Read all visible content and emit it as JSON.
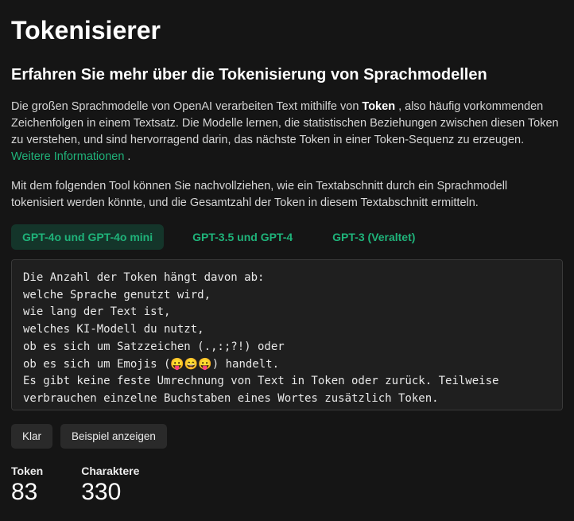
{
  "title": "Tokenisierer",
  "subtitle": "Erfahren Sie mehr über die Tokenisierung von Sprachmodellen",
  "para1_pre": "Die großen Sprachmodelle von OpenAI verarbeiten Text mithilfe von ",
  "para1_strong": "Token",
  "para1_post": " , also häufig vorkommenden Zeichenfolgen in einem Textsatz. Die Modelle lernen, die statistischen Beziehungen zwischen diesen Token zu verstehen, und sind hervorragend darin, das nächste Token in einer Token-Sequenz zu erzeugen. ",
  "para1_link": "Weitere Informationen",
  "para1_end": " .",
  "para2": "Mit dem folgenden Tool können Sie nachvollziehen, wie ein Textabschnitt durch ein Sprachmodell tokenisiert werden könnte, und die Gesamtzahl der Token in diesem Textabschnitt ermitteln.",
  "tabs": {
    "t0": "GPT-4o und GPT-4o mini",
    "t1": "GPT-3.5 und GPT-4",
    "t2": "GPT-3 (Veraltet)"
  },
  "input_text": "Die Anzahl der Token hängt davon ab:\nwelche Sprache genutzt wird,\nwie lang der Text ist,\nwelches KI-Modell du nutzt,\nob es sich um Satzzeichen (.,:;?!) oder\nob es sich um Emojis (😛😄😛) handelt.\nEs gibt keine feste Umrechnung von Text in Token oder zurück. Teilweise verbrauchen einzelne Buchstaben eines Wortes zusätzlich Token.",
  "buttons": {
    "clear": "Klar",
    "example": "Beispiel anzeigen"
  },
  "stats": {
    "token_label": "Token",
    "token_value": "83",
    "char_label": "Charaktere",
    "char_value": "330"
  }
}
